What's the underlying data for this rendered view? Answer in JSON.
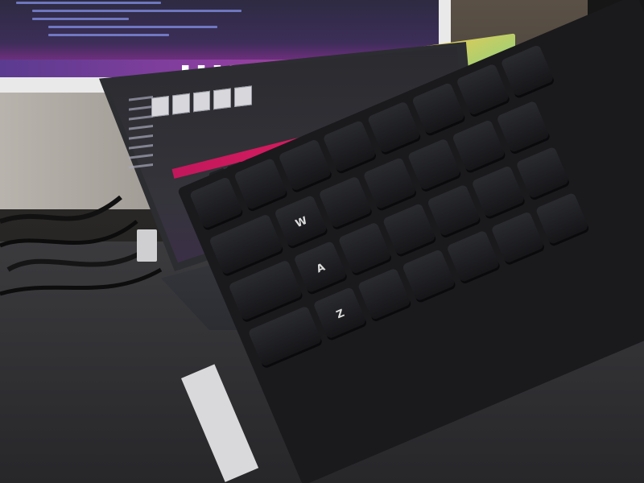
{
  "scene": {
    "description_colors": {
      "monitor_accent": "#8c3fa0",
      "laptop_taskbar": "#d81b60",
      "intel_badge": "#1a3fb5",
      "nvidia_badge": "#76b900"
    }
  },
  "keyboard": {
    "keys_row1": [
      "",
      "",
      "",
      "",
      "",
      "",
      "",
      ""
    ],
    "keys_row2": [
      "",
      "W",
      "",
      "",
      "",
      "",
      "",
      ""
    ],
    "keys_row3": [
      "",
      "A",
      "",
      "",
      "",
      "",
      "",
      ""
    ],
    "keys_row4": [
      "",
      "Z",
      "",
      "",
      "",
      "",
      "",
      ""
    ]
  }
}
